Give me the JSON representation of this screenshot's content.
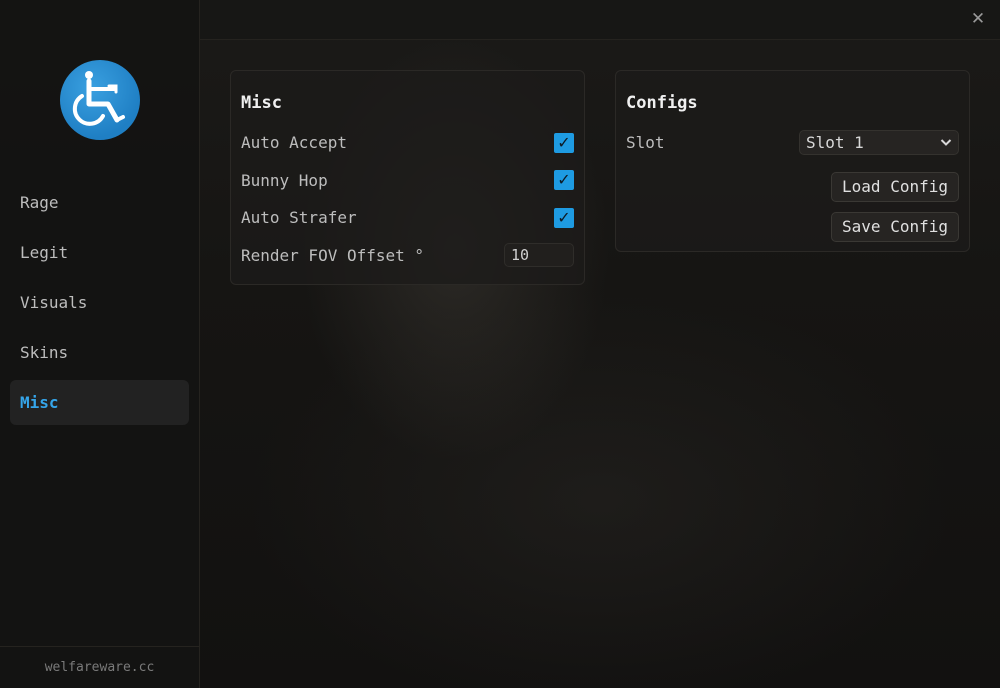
{
  "sidebar": {
    "logo_icon": "wheelchair-icon",
    "items": [
      {
        "label": "Rage",
        "active": false
      },
      {
        "label": "Legit",
        "active": false
      },
      {
        "label": "Visuals",
        "active": false
      },
      {
        "label": "Skins",
        "active": false
      },
      {
        "label": "Misc",
        "active": true
      }
    ],
    "footer": "welfareware.cc"
  },
  "window": {
    "close_label": "✕"
  },
  "misc_panel": {
    "title": "Misc",
    "auto_accept": {
      "label": "Auto Accept",
      "checked": true
    },
    "bunny_hop": {
      "label": "Bunny Hop",
      "checked": true
    },
    "auto_strafer": {
      "label": "Auto Strafer",
      "checked": true
    },
    "render_fov": {
      "label": "Render FOV Offset °",
      "value": "10"
    }
  },
  "configs_panel": {
    "title": "Configs",
    "slot_label": "Slot",
    "slot_value": "Slot 1",
    "load_button": "Load Config",
    "save_button": "Save Config"
  },
  "colors": {
    "accent": "#35a5ea",
    "checkbox": "#1e9be2",
    "background": "#141312"
  }
}
